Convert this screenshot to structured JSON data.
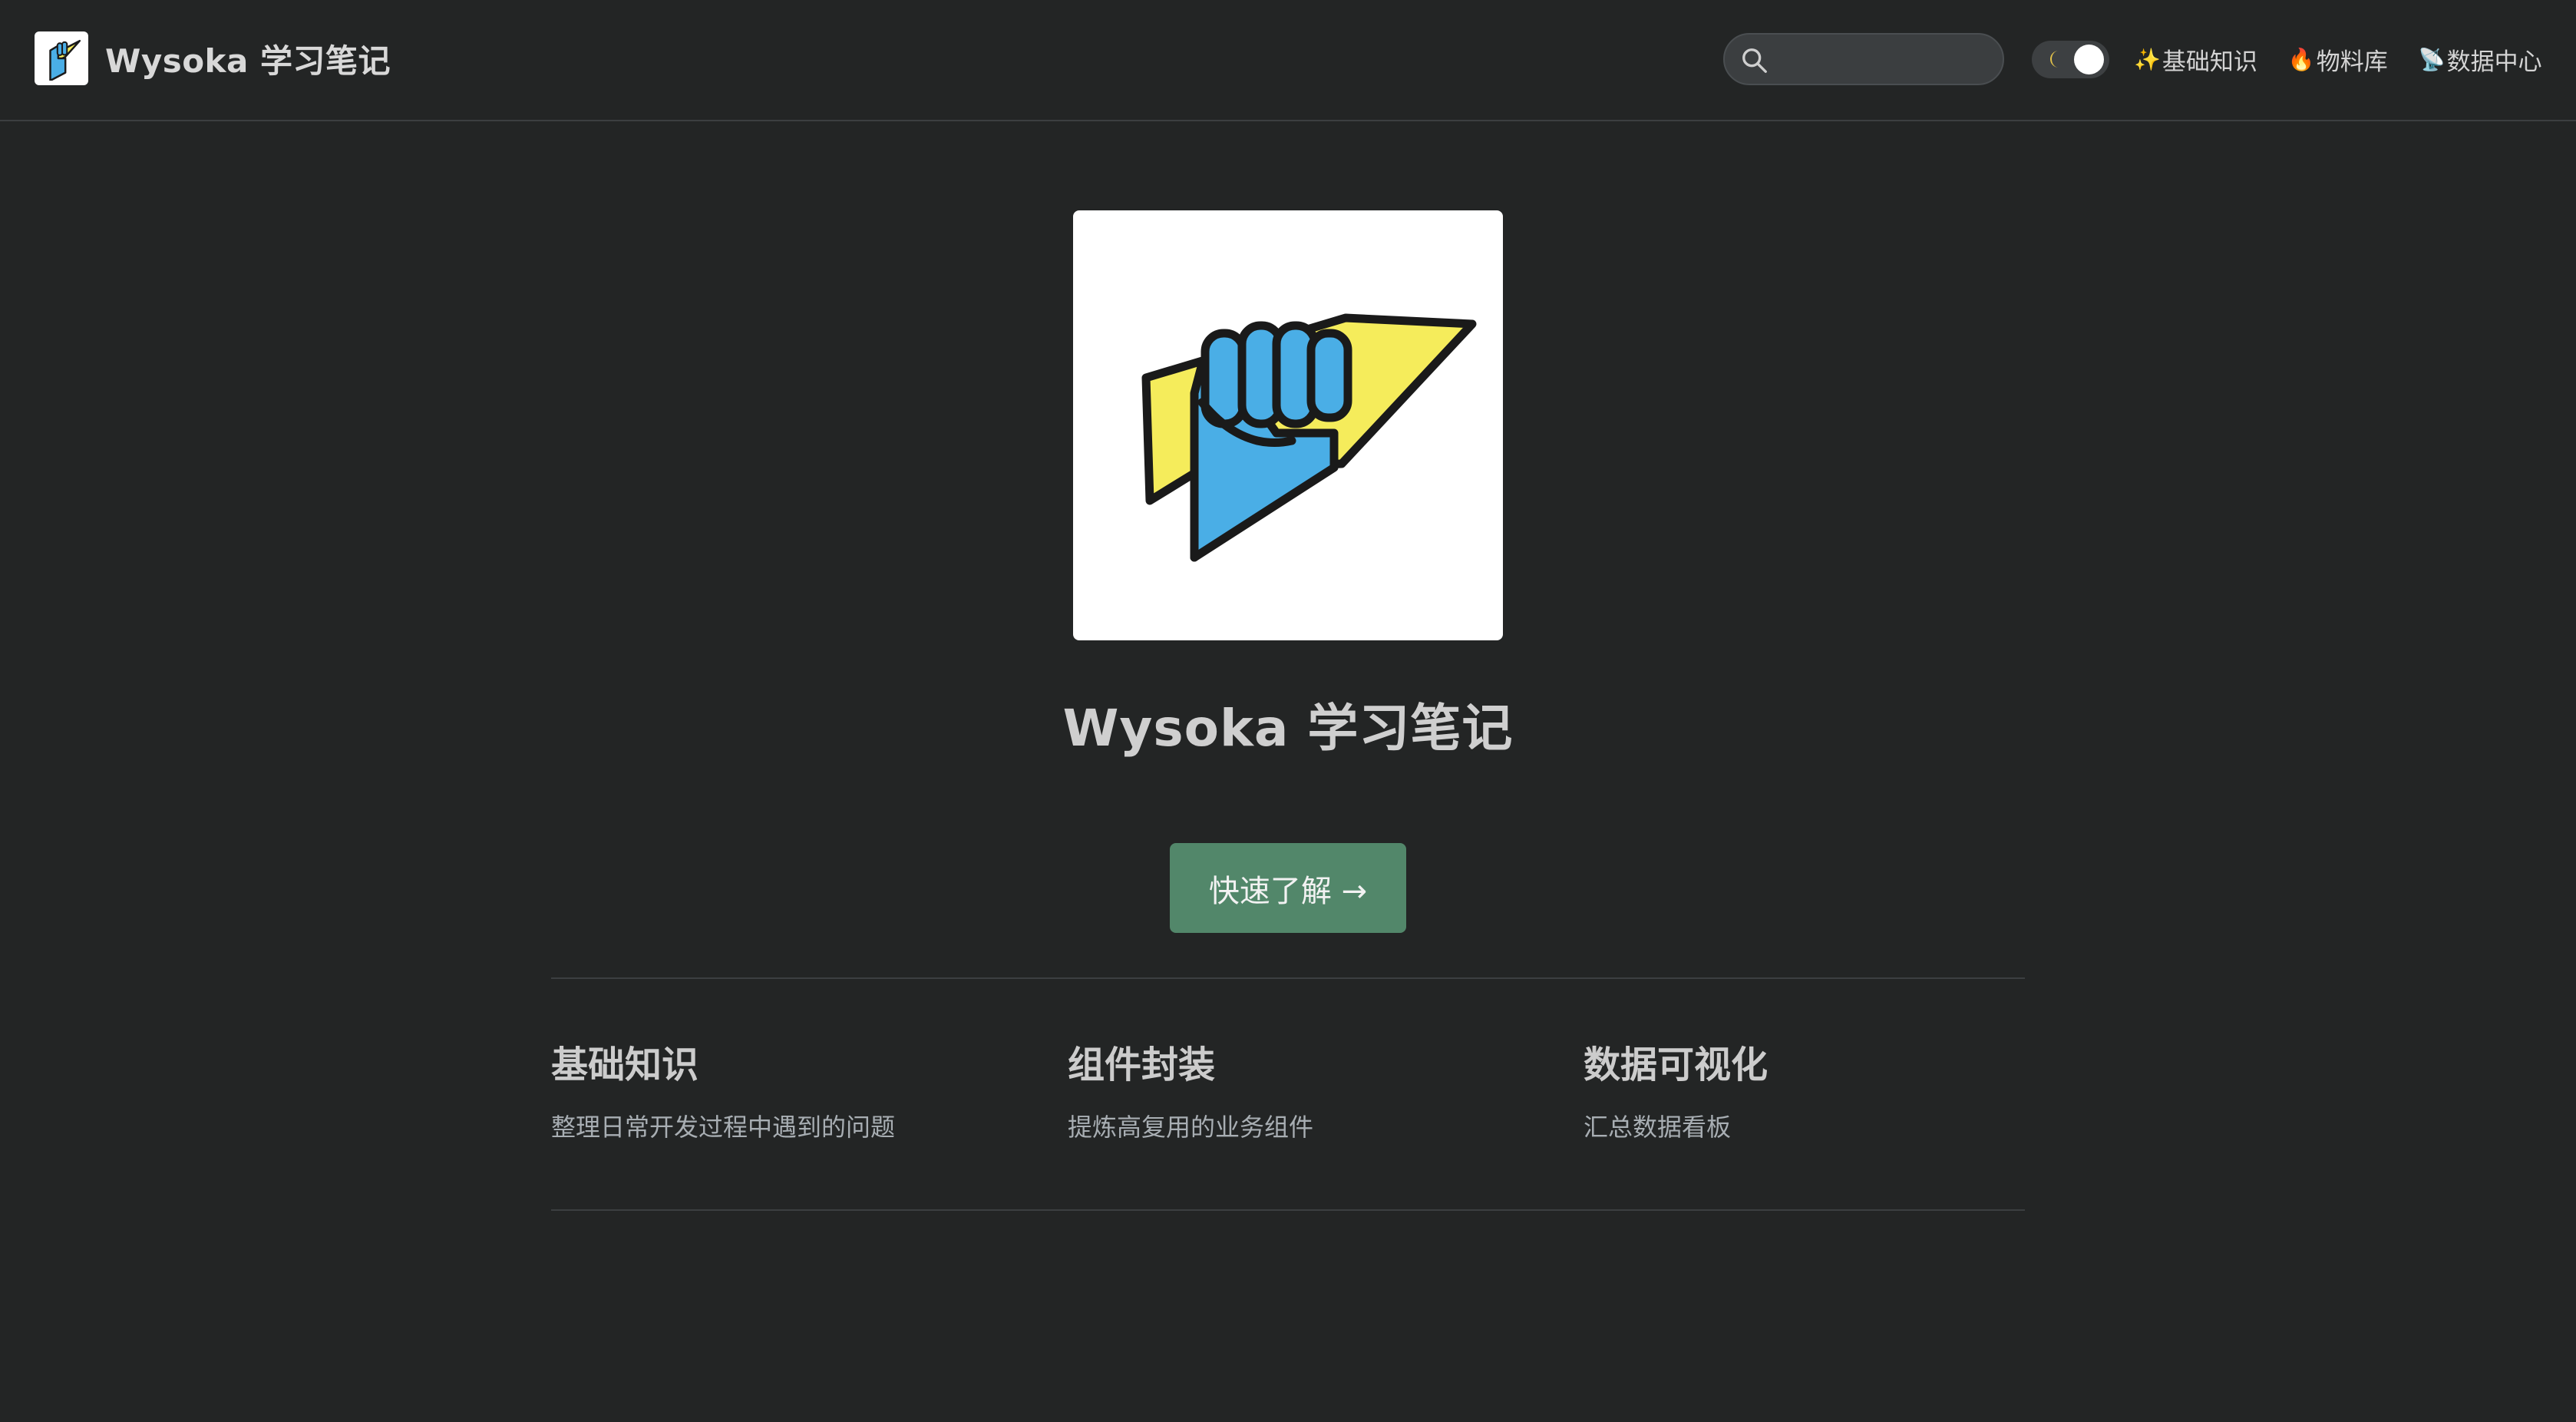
{
  "header": {
    "brand_title": "Wysoka 学习笔记",
    "logo_icon": "fist-lightning-logo",
    "search": {
      "placeholder": "",
      "value": "",
      "icon": "search-icon"
    },
    "theme_toggle": {
      "icon": "moon-icon",
      "state": "dark"
    },
    "nav": [
      {
        "emoji": "✨",
        "label": "基础知识"
      },
      {
        "emoji": "🔥",
        "label": "物料库"
      },
      {
        "emoji": "📡",
        "label": "数据中心"
      }
    ]
  },
  "hero": {
    "logo_icon": "fist-lightning-logo",
    "title": "Wysoka 学习笔记",
    "cta_label": "快速了解 →"
  },
  "features": [
    {
      "title": "基础知识",
      "desc": "整理日常开发过程中遇到的问题"
    },
    {
      "title": "组件封装",
      "desc": "提炼高复用的业务组件"
    },
    {
      "title": "数据可视化",
      "desc": "汇总数据看板"
    }
  ],
  "colors": {
    "background": "#232525",
    "accent_button": "#52876a",
    "logo_blue": "#4aaee6",
    "logo_yellow": "#f5ec5b"
  }
}
